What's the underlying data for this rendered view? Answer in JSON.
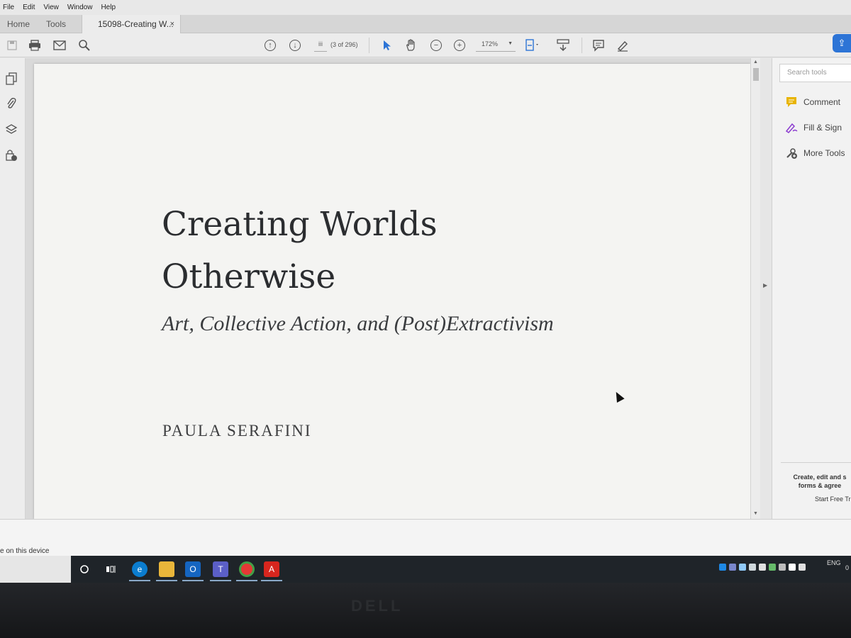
{
  "menubar": {
    "items": [
      "File",
      "Edit",
      "View",
      "Window",
      "Help"
    ]
  },
  "tabs": {
    "home": "Home",
    "tools": "Tools",
    "document": "15098-Creating W...",
    "close": "×"
  },
  "toolbar": {
    "page_input": "iii",
    "page_count": "(3 of 296)",
    "zoom": "172%"
  },
  "document": {
    "title": "Creating Worlds\nOtherwise",
    "subtitle": "Art, Collective Action, and (Post)Extractivism",
    "author": "PAULA SERAFINI"
  },
  "tools_pane": {
    "search_placeholder": "Search tools",
    "items": [
      {
        "label": "Comment",
        "icon": "comment-icon"
      },
      {
        "label": "Fill & Sign",
        "icon": "pen-icon"
      },
      {
        "label": "More Tools",
        "icon": "tools-icon"
      }
    ],
    "promo": "Create, edit and s\nforms & agree",
    "promo_link": "Start Free Tri"
  },
  "status": {
    "device_text": "e on this device"
  },
  "taskbar": {
    "lang": "ENG",
    "clock": "0"
  },
  "monitor": {
    "brand": "DELL"
  },
  "colors": {
    "accent": "#2d74d6",
    "comment": "#e8b400",
    "sign": "#8b3ccf",
    "acrobat": "#d7261e"
  }
}
